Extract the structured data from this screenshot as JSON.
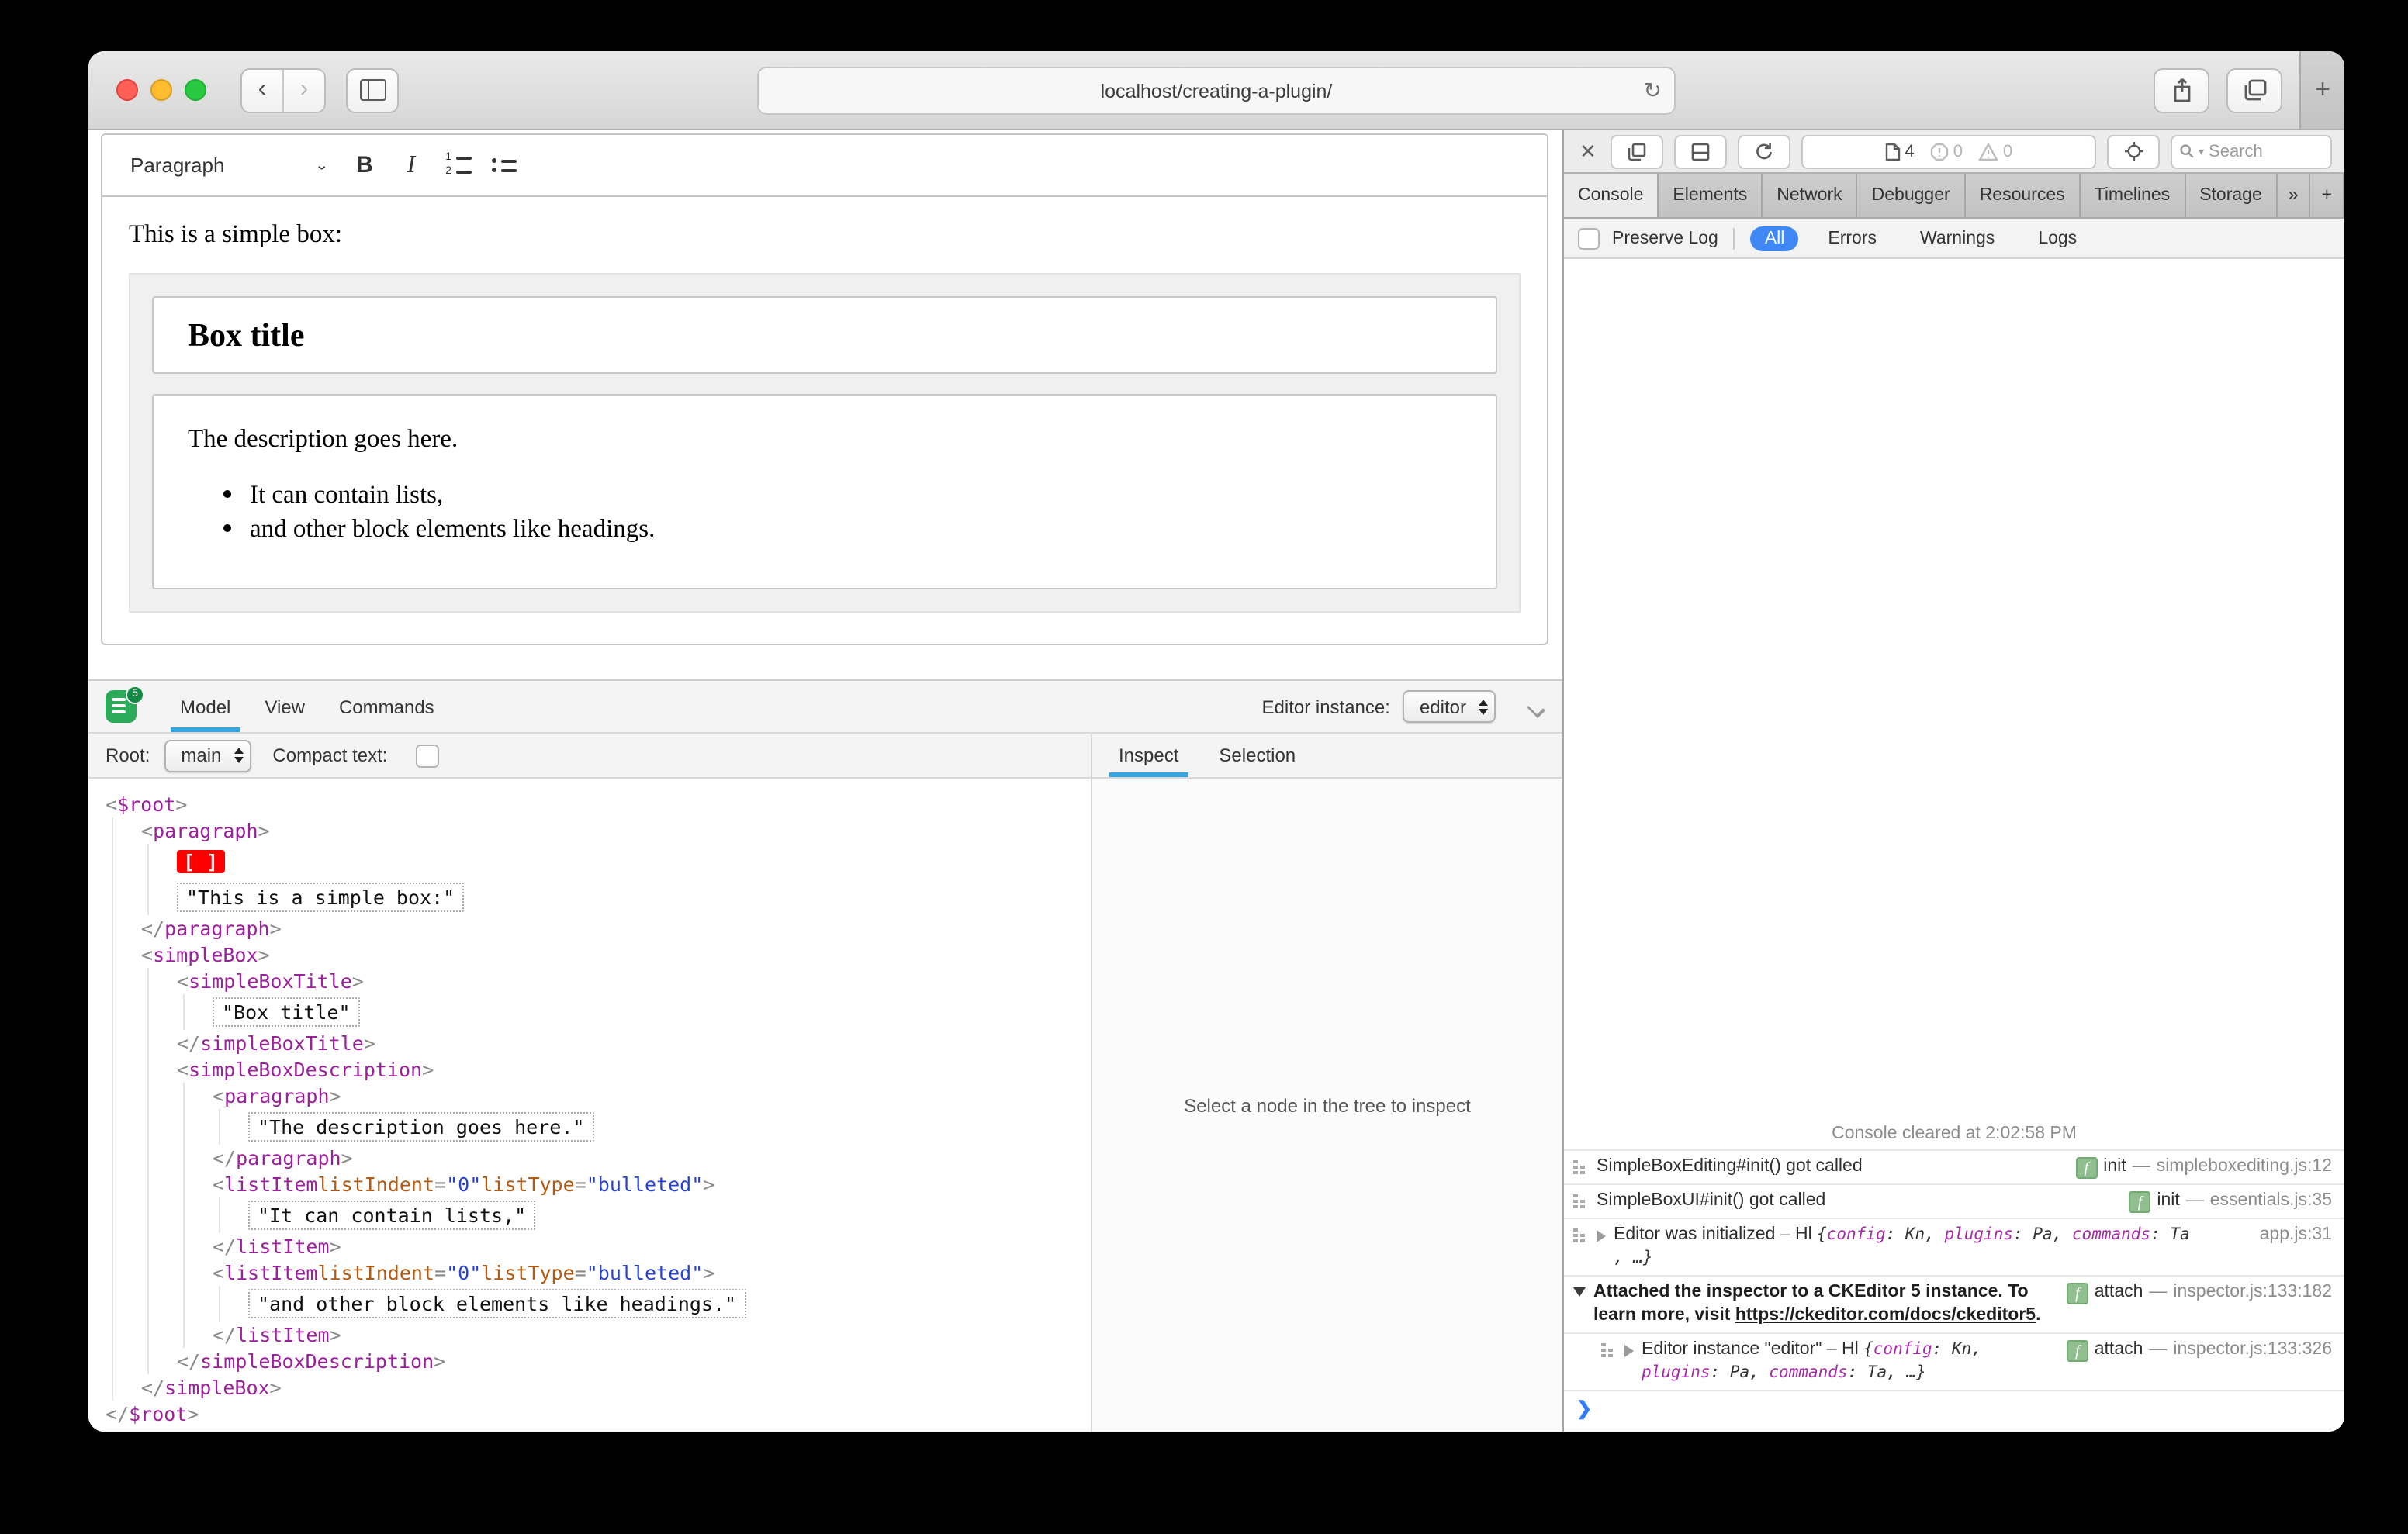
{
  "browser": {
    "url": "localhost/creating-a-plugin/",
    "back_label": "‹",
    "forward_label": "›",
    "reload_label": "↻",
    "new_tab_label": "+"
  },
  "editor": {
    "toolbar": {
      "paragraph_dropdown": "Paragraph",
      "dropdown_chevron": "⌄",
      "bold": "B",
      "italic": "I"
    },
    "content": {
      "intro": "This is a simple box:",
      "box_title": "Box title",
      "description": "The description goes here.",
      "list_items": [
        "It can contain lists,",
        "and other block elements like headings."
      ]
    }
  },
  "inspector": {
    "logo_badge": "5",
    "tabs": [
      {
        "label": "Model",
        "active": true
      },
      {
        "label": "View",
        "active": false
      },
      {
        "label": "Commands",
        "active": false
      }
    ],
    "editor_instance_label": "Editor instance:",
    "editor_instance_value": "editor",
    "root_label": "Root:",
    "root_value": "main",
    "compact_text_label": "Compact text:",
    "side_tabs": [
      {
        "label": "Inspect",
        "active": true
      },
      {
        "label": "Selection",
        "active": false
      }
    ],
    "empty_message": "Select a node in the tree to inspect",
    "tree": [
      {
        "indent": 0,
        "tokens": [
          [
            "p",
            "<"
          ],
          [
            "g",
            "$root"
          ],
          [
            "p",
            ">"
          ]
        ]
      },
      {
        "indent": 1,
        "tokens": [
          [
            "p",
            "<"
          ],
          [
            "g",
            "paragraph"
          ],
          [
            "p",
            ">"
          ]
        ]
      },
      {
        "indent": 2,
        "tokens": [
          [
            "m",
            "[ ]"
          ]
        ]
      },
      {
        "indent": 2,
        "tokens": [
          [
            "s",
            "\"This is a simple box:\""
          ]
        ]
      },
      {
        "indent": 1,
        "tokens": [
          [
            "p",
            "</"
          ],
          [
            "g",
            "paragraph"
          ],
          [
            "p",
            ">"
          ]
        ]
      },
      {
        "indent": 1,
        "tokens": [
          [
            "p",
            "<"
          ],
          [
            "g",
            "simpleBox"
          ],
          [
            "p",
            ">"
          ]
        ]
      },
      {
        "indent": 2,
        "tokens": [
          [
            "p",
            "<"
          ],
          [
            "g",
            "simpleBoxTitle"
          ],
          [
            "p",
            ">"
          ]
        ]
      },
      {
        "indent": 3,
        "tokens": [
          [
            "s",
            "\"Box title\""
          ]
        ]
      },
      {
        "indent": 2,
        "tokens": [
          [
            "p",
            "</"
          ],
          [
            "g",
            "simpleBoxTitle"
          ],
          [
            "p",
            ">"
          ]
        ]
      },
      {
        "indent": 2,
        "tokens": [
          [
            "p",
            "<"
          ],
          [
            "g",
            "simpleBoxDescription"
          ],
          [
            "p",
            ">"
          ]
        ]
      },
      {
        "indent": 3,
        "tokens": [
          [
            "p",
            "<"
          ],
          [
            "g",
            "paragraph"
          ],
          [
            "p",
            ">"
          ]
        ]
      },
      {
        "indent": 4,
        "tokens": [
          [
            "s",
            "\"The description goes here.\""
          ]
        ]
      },
      {
        "indent": 3,
        "tokens": [
          [
            "p",
            "</"
          ],
          [
            "g",
            "paragraph"
          ],
          [
            "p",
            ">"
          ]
        ]
      },
      {
        "indent": 3,
        "tokens": [
          [
            "p",
            "<"
          ],
          [
            "g",
            "listItem"
          ],
          [
            "a",
            " listIndent"
          ],
          [
            "p",
            "="
          ],
          [
            "v",
            "\"0\""
          ],
          [
            "a",
            " listType"
          ],
          [
            "p",
            "="
          ],
          [
            "v",
            "\"bulleted\""
          ],
          [
            "p",
            ">"
          ]
        ]
      },
      {
        "indent": 4,
        "tokens": [
          [
            "s",
            "\"It can contain lists,\""
          ]
        ]
      },
      {
        "indent": 3,
        "tokens": [
          [
            "p",
            "</"
          ],
          [
            "g",
            "listItem"
          ],
          [
            "p",
            ">"
          ]
        ]
      },
      {
        "indent": 3,
        "tokens": [
          [
            "p",
            "<"
          ],
          [
            "g",
            "listItem"
          ],
          [
            "a",
            " listIndent"
          ],
          [
            "p",
            "="
          ],
          [
            "v",
            "\"0\""
          ],
          [
            "a",
            " listType"
          ],
          [
            "p",
            "="
          ],
          [
            "v",
            "\"bulleted\""
          ],
          [
            "p",
            ">"
          ]
        ]
      },
      {
        "indent": 4,
        "tokens": [
          [
            "s",
            "\"and other block elements like headings.\""
          ]
        ]
      },
      {
        "indent": 3,
        "tokens": [
          [
            "p",
            "</"
          ],
          [
            "g",
            "listItem"
          ],
          [
            "p",
            ">"
          ]
        ]
      },
      {
        "indent": 2,
        "tokens": [
          [
            "p",
            "</"
          ],
          [
            "g",
            "simpleBoxDescription"
          ],
          [
            "p",
            ">"
          ]
        ]
      },
      {
        "indent": 1,
        "tokens": [
          [
            "p",
            "</"
          ],
          [
            "g",
            "simpleBox"
          ],
          [
            "p",
            ">"
          ]
        ]
      },
      {
        "indent": 0,
        "tokens": [
          [
            "p",
            "</"
          ],
          [
            "g",
            "$root"
          ],
          [
            "p",
            ">"
          ]
        ]
      }
    ],
    "colors": {
      "tab_underline": "#38a5e0",
      "tag": "#9c1f9c",
      "attr": "#b05a14",
      "value": "#2843cf",
      "marker_bg": "#ff0000",
      "logo_green": "#2bab5a"
    }
  },
  "devtools": {
    "close_label": "✕",
    "tab_count": "4",
    "error_count": "0",
    "warning_count": "0",
    "search_placeholder": "Search",
    "tabs": [
      {
        "label": "Console",
        "active": true
      },
      {
        "label": "Elements",
        "active": false
      },
      {
        "label": "Network",
        "active": false
      },
      {
        "label": "Debugger",
        "active": false
      },
      {
        "label": "Resources",
        "active": false
      },
      {
        "label": "Timelines",
        "active": false
      },
      {
        "label": "Storage",
        "active": false
      }
    ],
    "more_tabs_label": "»",
    "add_tab_label": "+",
    "settings_icon": "⚙",
    "filter": {
      "preserve_log": "Preserve Log",
      "scopes": [
        {
          "label": "All",
          "active": true
        },
        {
          "label": "Errors",
          "active": false
        },
        {
          "label": "Warnings",
          "active": false
        },
        {
          "label": "Logs",
          "active": false
        }
      ],
      "accent": "#3f87f5"
    },
    "console": {
      "cleared": "Console cleared at 2:02:58 PM",
      "prompt": "❯",
      "rows": [
        {
          "icon": true,
          "lines": [
            [
              [
                "t",
                "SimpleBoxEditing#init() got called"
              ]
            ]
          ],
          "right": {
            "badge": "f",
            "fn": "init",
            "loc": "simpleboxediting.js:12"
          }
        },
        {
          "icon": true,
          "lines": [
            [
              [
                "t",
                "SimpleBoxUI#init() got called"
              ]
            ]
          ],
          "right": {
            "badge": "f",
            "fn": "init",
            "loc": "essentials.js:35"
          }
        },
        {
          "icon": true,
          "disclosure": "right",
          "lines": [
            [
              [
                "t",
                "Editor was initialized"
              ],
              [
                "dim",
                " – "
              ],
              [
                "t",
                "Hl "
              ],
              [
                "ov",
                "{"
              ],
              [
                "ok",
                "config"
              ],
              [
                "ov",
                ": Kn, "
              ],
              [
                "ok",
                "plugins"
              ],
              [
                "ov",
                ": Pa, "
              ],
              [
                "ok",
                "commands"
              ],
              [
                "ov",
                ": Ta"
              ]
            ],
            [
              [
                "ov",
                ", …}"
              ]
            ]
          ],
          "right": {
            "loc": "app.js:31"
          }
        },
        {
          "disclosure": "down",
          "lines": [
            [
              [
                "b",
                "Attached the inspector to a CKEditor 5 instance. To learn more, visit "
              ],
              [
                "link",
                "https://ckeditor.com/docs/ckeditor5"
              ],
              [
                "b",
                "."
              ]
            ]
          ],
          "right": {
            "badge": "f",
            "fn": "attach",
            "loc": "inspector.js:133:182"
          }
        },
        {
          "icon": true,
          "child": true,
          "disclosure": "right",
          "lines": [
            [
              [
                "t",
                "Editor instance \"editor\""
              ],
              [
                "dim",
                " – "
              ],
              [
                "t",
                "Hl "
              ],
              [
                "ov",
                "{"
              ],
              [
                "ok",
                "config"
              ],
              [
                "ov",
                ": Kn,"
              ]
            ],
            [
              [
                "ok",
                "plugins"
              ],
              [
                "ov",
                ": Pa, "
              ],
              [
                "ok",
                "commands"
              ],
              [
                "ov",
                ": Ta, …}"
              ]
            ]
          ],
          "right": {
            "badge": "f",
            "fn": "attach",
            "loc": "inspector.js:133:326"
          }
        }
      ]
    }
  }
}
